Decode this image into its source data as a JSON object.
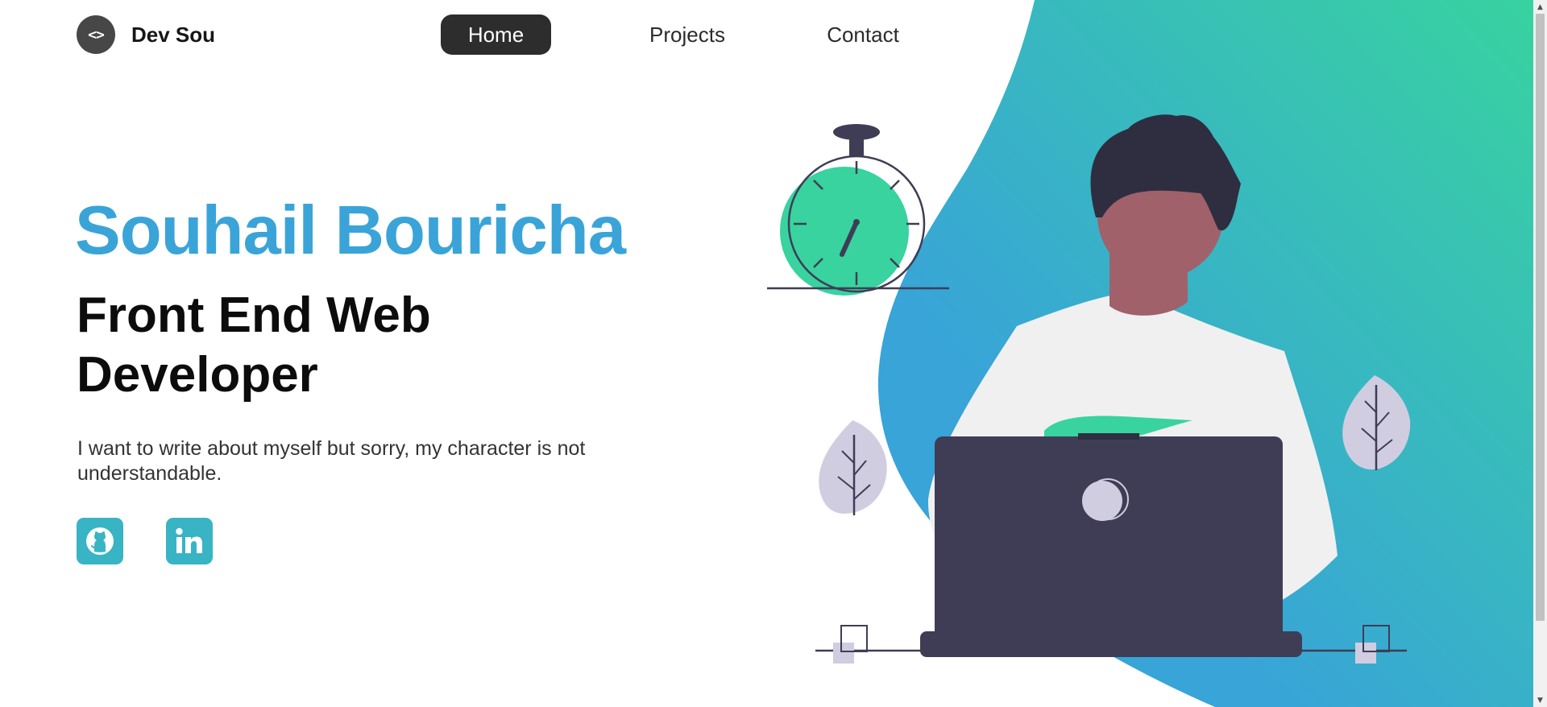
{
  "colors": {
    "accent_blue": "#3aa4d8",
    "gradient_green": "#38d39f",
    "gradient_blue": "#38a4d8",
    "dark": "#2d2d2d",
    "social_teal": "#39b4c4",
    "laptop": "#3f3d56",
    "skin": "#a0616a",
    "leaf": "#d0cde1"
  },
  "header": {
    "logo_symbol": "<>",
    "logo_text": "Dev Sou",
    "nav": [
      {
        "label": "Home",
        "active": true
      },
      {
        "label": "Projects",
        "active": false
      },
      {
        "label": "Contact",
        "active": false
      }
    ]
  },
  "hero": {
    "name": "Souhail Bouricha",
    "role_line1": "Front End Web",
    "role_line2": "Developer",
    "bio": "I want to write about myself but sorry, my character is not understandable."
  },
  "social": [
    {
      "icon": "github-icon"
    },
    {
      "icon": "linkedin-icon"
    }
  ],
  "illustration": {
    "elements": [
      "stopwatch",
      "developer-with-laptop",
      "plant-left",
      "plant-right"
    ]
  }
}
